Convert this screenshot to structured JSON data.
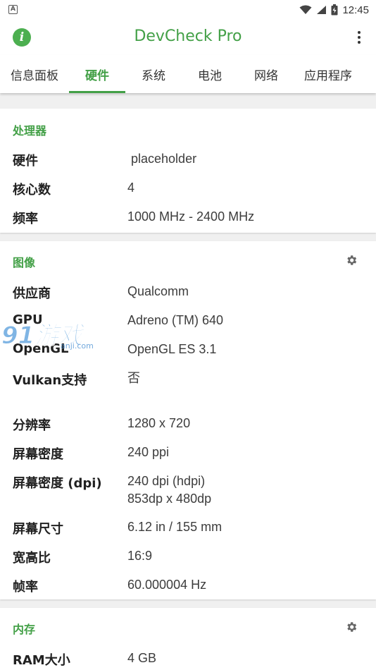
{
  "status_bar": {
    "time": "12:45",
    "notification_glyph": "A"
  },
  "app_bar": {
    "title": "DevCheck Pro",
    "icons": [
      "info-icon",
      "more-vert-icon"
    ]
  },
  "tabs": [
    {
      "label": "信息面板",
      "active": false
    },
    {
      "label": "硬件",
      "active": true
    },
    {
      "label": "系统",
      "active": false
    },
    {
      "label": "电池",
      "active": false
    },
    {
      "label": "网络",
      "active": false
    },
    {
      "label": "应用程序",
      "active": false
    }
  ],
  "processor": {
    "title": "处理器",
    "rows": [
      {
        "label": "硬件",
        "value": " placeholder"
      },
      {
        "label": "核心数",
        "value": "4"
      },
      {
        "label": "频率",
        "value": "1000 MHz - 2400 MHz"
      }
    ]
  },
  "graphics": {
    "title": "图像",
    "rows": [
      {
        "label": "供应商",
        "value": "Qualcomm"
      },
      {
        "label": "GPU",
        "value": "Adreno (TM) 640"
      },
      {
        "label": "OpenGL",
        "value": "OpenGL ES 3.1"
      },
      {
        "label": "Vulkan支持",
        "value": "否"
      },
      {
        "label": "分辨率",
        "value": "1280 x 720"
      },
      {
        "label": "屏幕密度",
        "value": "240 ppi"
      },
      {
        "label": "屏幕密度 (dpi)",
        "value": "240 dpi (hdpi)",
        "value2": "853dp x 480dp"
      },
      {
        "label": "屏幕尺寸",
        "value": "6.12 in / 155 mm"
      },
      {
        "label": "宽高比",
        "value": "16:9"
      },
      {
        "label": "帧率",
        "value": "60.000004 Hz"
      }
    ]
  },
  "memory": {
    "title": "内存",
    "rows": [
      {
        "label": "RAM大小",
        "value": "4 GB"
      }
    ]
  },
  "watermark": {
    "text": "91游戏",
    "sub": "anji.com"
  },
  "colors": {
    "accent": "#43a047",
    "background": "#f0f0f0"
  }
}
